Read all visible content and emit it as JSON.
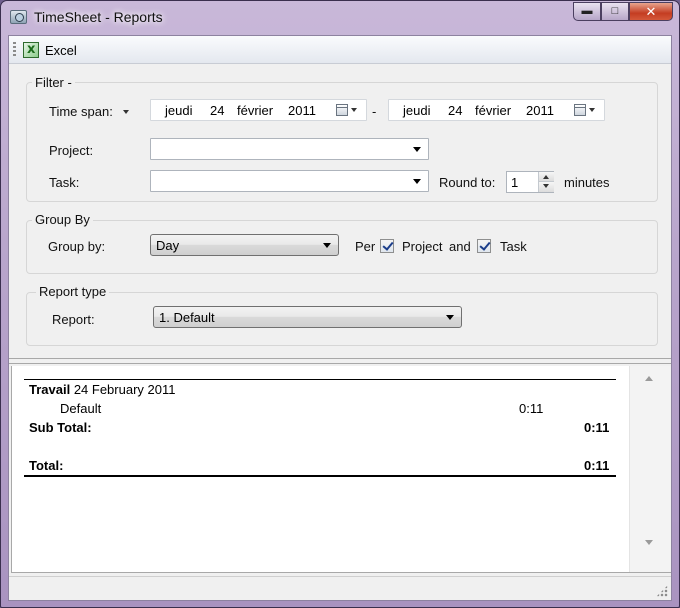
{
  "window": {
    "title": "TimeSheet - Reports",
    "minimize_glyph": "▬",
    "maximize_glyph": "□",
    "close_glyph": "✕"
  },
  "toolbar": {
    "excel_label": "Excel"
  },
  "filter": {
    "legend": "Filter -",
    "time_span_label": "Time span:",
    "date_from": {
      "weekday": "jeudi",
      "day": "24",
      "month": "février",
      "year": "2011"
    },
    "date_separator": "-",
    "date_to": {
      "weekday": "jeudi",
      "day": "24",
      "month": "février",
      "year": "2011"
    },
    "project_label": "Project:",
    "project_value": "",
    "task_label": "Task:",
    "task_value": "",
    "round_label": "Round to:",
    "round_value": "1",
    "round_unit": "minutes"
  },
  "group_by": {
    "legend": "Group By",
    "label": "Group by:",
    "value": "Day",
    "per_label": "Per",
    "project_label": "Project",
    "project_checked": true,
    "and_label": "and",
    "task_label": "Task",
    "task_checked": true
  },
  "report_type": {
    "legend": "Report type",
    "label": "Report:",
    "value": "1. Default"
  },
  "report": {
    "group_title_bold": "Travail",
    "group_title_rest": " 24 February 2011",
    "rows": [
      {
        "name": "Default",
        "value": "0:11"
      }
    ],
    "subtotal_label": "Sub Total:",
    "subtotal_value": "0:11",
    "total_label": "Total:",
    "total_value": "0:11"
  },
  "icons": {
    "app": "timesheet-app-icon",
    "excel": "excel-icon",
    "calendar": "calendar-icon",
    "dropdown": "chevron-down-icon"
  }
}
